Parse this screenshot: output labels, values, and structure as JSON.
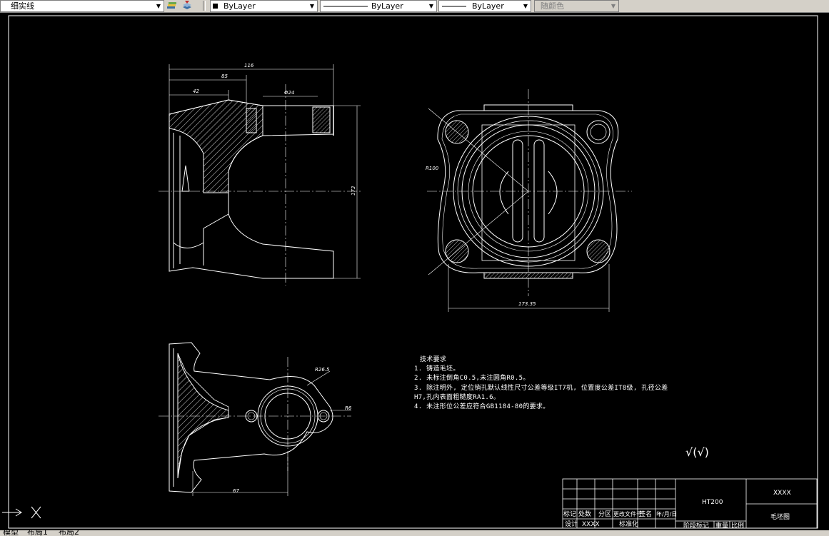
{
  "toolbar": {
    "linetype_layer_combo": "细实线",
    "color_combo": "ByLayer",
    "linetype_combo": "ByLayer",
    "lineweight_combo": "ByLayer",
    "plotstyle_combo": "随颜色",
    "icons": [
      "layer-states-icon",
      "layer-previous-icon"
    ]
  },
  "tabs": [
    "模型",
    "布局1",
    "布局2"
  ],
  "drawing": {
    "technical_requirements": {
      "title": "技术要求",
      "items": [
        "1. 铸造毛坯。",
        "2. 未标注倒角C0.5,未注圆角R0.5。",
        "3. 除注明外, 定位销孔默认线性尺寸公差等级IT7机, 位置度公差IT8级, 孔径公差",
        "H7,孔内表面粗糙度RA1.6。",
        "4. 未注形位公差应符合GB1184-80的要求。"
      ]
    },
    "roughness_symbol": "√(√)",
    "dimensions": {
      "overall_length": "116",
      "length_2": "85",
      "length_3": "42",
      "diameter": "Φ24",
      "height": "173",
      "radius_view2": "R100",
      "width_view2": "173.35",
      "radius_view3_a": "R26.5",
      "radius_view3_b": "R6",
      "length_view3": "67"
    },
    "title_block": {
      "material": "HT200",
      "company": "XXXX",
      "drawing_name": "毛坯图",
      "headers": [
        "标记",
        "处数",
        "分区",
        "更改文件号",
        "签名",
        "年/月/日"
      ],
      "row2": [
        "设计",
        "XXXX",
        "标准化"
      ],
      "row3": [
        "阶段标记",
        "重量",
        "比例"
      ]
    }
  }
}
